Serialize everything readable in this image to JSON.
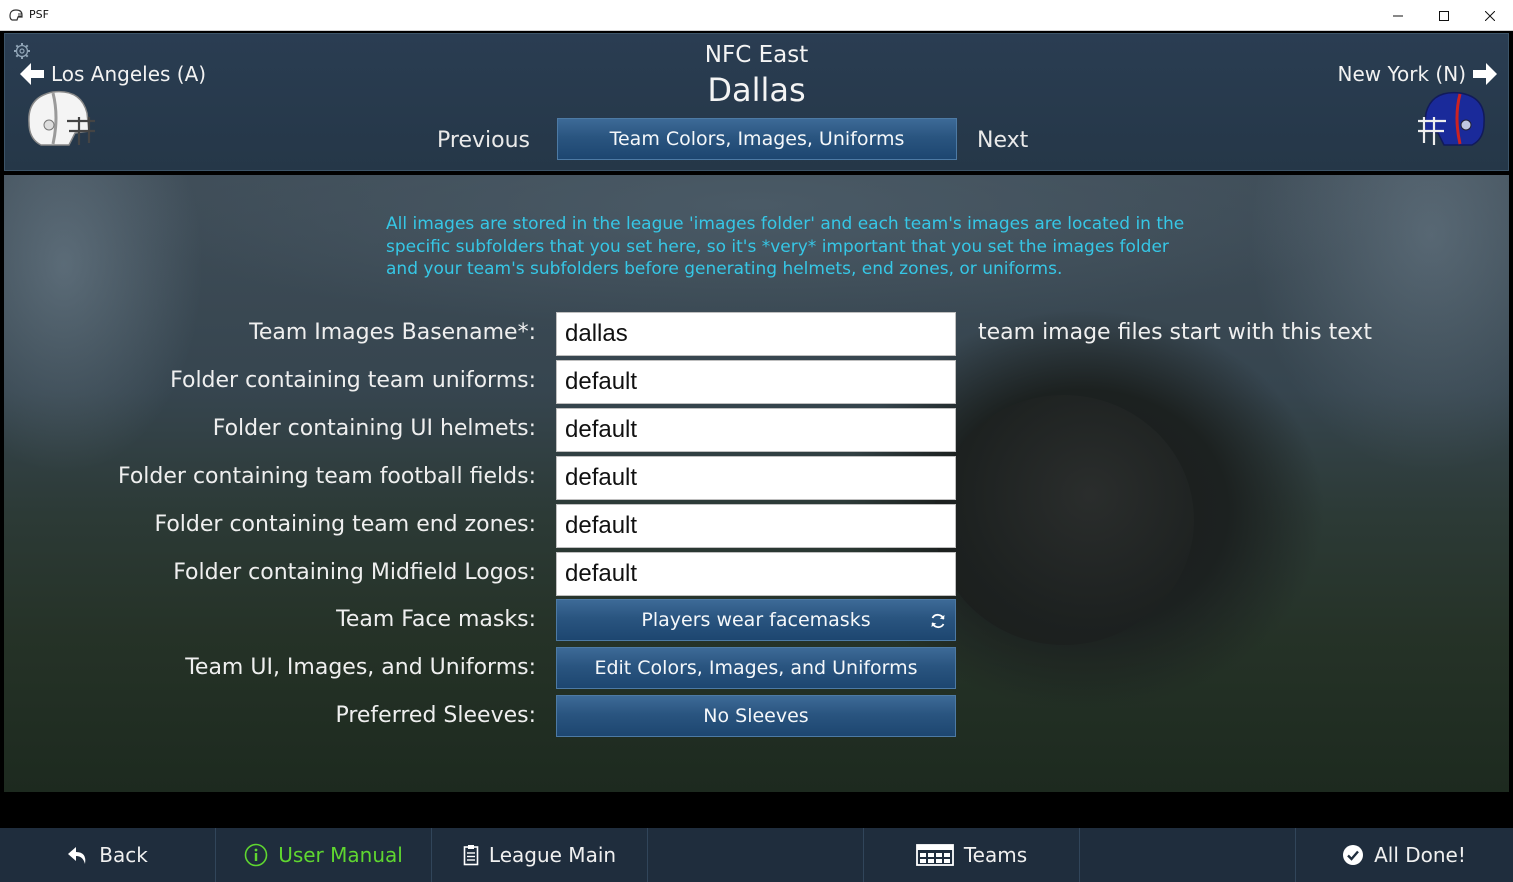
{
  "window": {
    "title": "PSF"
  },
  "header": {
    "division": "NFC East",
    "team_name": "Dallas",
    "prev_team": "Los Angeles (A)",
    "next_team": "New York (N)",
    "prev_label": "Previous",
    "next_label": "Next",
    "section_button": "Team Colors, Images, Uniforms"
  },
  "main": {
    "info_text": "All images are stored in the league 'images folder' and each team's images are located in the specific subfolders that you set here, so it's *very* important that you set the images folder and your team's subfolders before generating helmets, end zones, or uniforms.",
    "fields": [
      {
        "label": "Team Images Basename*:",
        "value": "dallas"
      },
      {
        "label": "Folder containing team uniforms:",
        "value": "default"
      },
      {
        "label": "Folder containing UI helmets:",
        "value": "default"
      },
      {
        "label": "Folder containing team football fields:",
        "value": "default"
      },
      {
        "label": "Folder containing team end zones:",
        "value": "default"
      },
      {
        "label": "Folder containing Midfield Logos:",
        "value": "default"
      }
    ],
    "basename_hint": "team image files start with this text",
    "buttons": [
      {
        "label": "Team Face masks:",
        "value": "Players wear facemasks"
      },
      {
        "label": "Team UI, Images, and Uniforms:",
        "value": "Edit Colors, Images, and Uniforms"
      },
      {
        "label": "Preferred Sleeves:",
        "value": "No Sleeves"
      }
    ]
  },
  "bottom": {
    "back": "Back",
    "manual": "User Manual",
    "league_main": "League Main",
    "teams": "Teams",
    "done": "All Done!"
  },
  "colors": {
    "accent_blue": "#2a5580",
    "info_cyan": "#36c7e6",
    "manual_green": "#5fd630",
    "header_bg": "#2a3d52"
  }
}
